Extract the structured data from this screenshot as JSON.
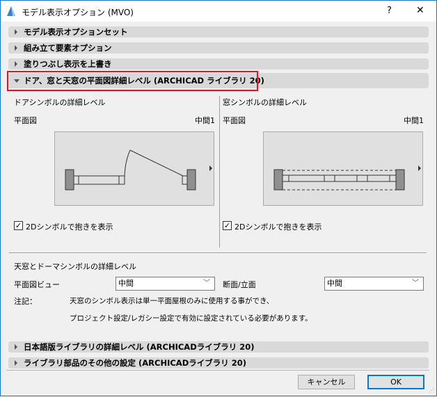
{
  "title": "モデル表示オプション (MVO)",
  "help_label": "?",
  "close_label": "✕",
  "sections": [
    {
      "label": "モデル表示オプションセット",
      "expanded": false
    },
    {
      "label": "組み立て要素オプション",
      "expanded": false
    },
    {
      "label": "塗りつぶし表示を上書き",
      "expanded": false
    },
    {
      "label": "ドア、窓と天窓の平面図詳細レベル (ARCHICAD ライブラリ 20)",
      "expanded": true
    },
    {
      "label": "日本語版ライブラリの詳細レベル (ARCHICADライブラリ 20)",
      "expanded": false
    },
    {
      "label": "ライブラリ部品のその他の設定 (ARCHICADライブラリ 20)",
      "expanded": false
    }
  ],
  "door": {
    "heading": "ドアシンボルの詳細レベル",
    "view": "平面図",
    "level": "中間1",
    "checkbox": "2Dシンボルで抱きを表示",
    "checked": true
  },
  "window": {
    "heading": "窓シンボルの詳細レベル",
    "view": "平面図",
    "level": "中間1",
    "checkbox": "2Dシンボルで抱きを表示",
    "checked": true
  },
  "skylight": {
    "heading": "天窓とドーマシンボルの詳細レベル",
    "plan_label": "平面図ビュー",
    "plan_value": "中間",
    "section_label": "断面/立面",
    "section_value": "中間",
    "note_label": "注記：",
    "note_line1": "天窓のシンボル表示は単一平面屋根のみに使用する事ができ、",
    "note_line2": "プロジェクト設定/レガシー設定で有効に設定されている必要があります。"
  },
  "buttons": {
    "cancel": "キャンセル",
    "ok": "OK"
  },
  "colors": {
    "accent": "#0078d7",
    "highlight": "#e81123"
  }
}
